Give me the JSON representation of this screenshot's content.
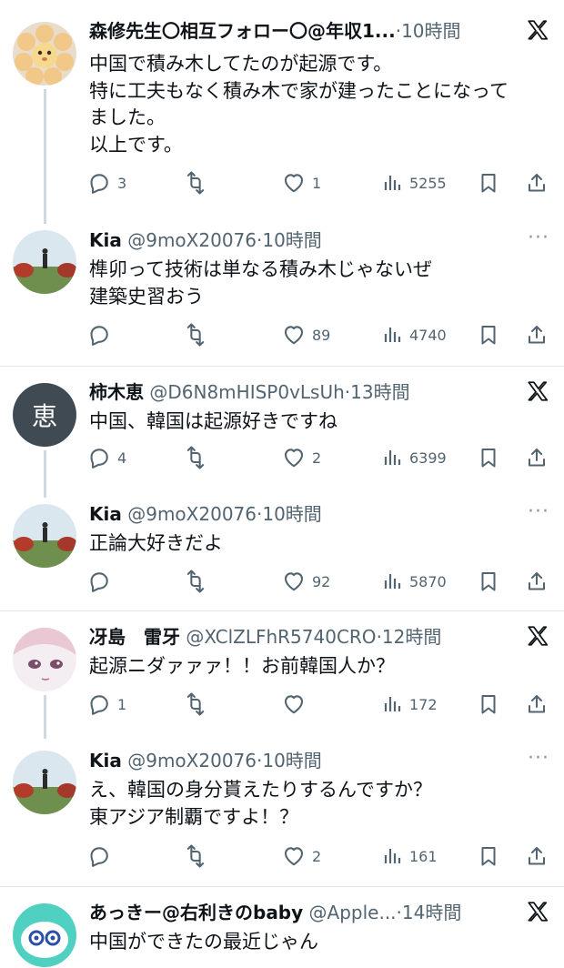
{
  "tweets": [
    {
      "name": "森修先生〇相互フォロー〇@年収1...",
      "handle": "",
      "time": "10時間",
      "lines": [
        "中国で積み木してたのが起源です。",
        "特に工夫もなく積み木で家が建ったことになって",
        "ました。",
        "以上です。"
      ],
      "reply_count": "3",
      "retweet_count": "",
      "like_count": "1",
      "view_count": "5255"
    },
    {
      "name": "Kia",
      "handle": "@9moX20076",
      "time": "10時間",
      "lines": [
        "榫卯って技術は単なる積み木じゃないぜ",
        "建築史習おう"
      ],
      "reply_count": "",
      "retweet_count": "",
      "like_count": "89",
      "view_count": "4740"
    },
    {
      "name": "柿木恵",
      "handle": "@D6N8mHISP0vLsUh",
      "time": "13時間",
      "avatar_text": "恵",
      "lines": [
        "中国、韓国は起源好きですね"
      ],
      "reply_count": "4",
      "retweet_count": "",
      "like_count": "2",
      "view_count": "6399"
    },
    {
      "name": "Kia",
      "handle": "@9moX20076",
      "time": "10時間",
      "lines": [
        "正論大好きだよ"
      ],
      "reply_count": "",
      "retweet_count": "",
      "like_count": "92",
      "view_count": "5870"
    },
    {
      "name": "冴島　雷牙",
      "handle": "@XClZLFhR5740CRO",
      "time": "12時間",
      "lines": [
        "起源ニダァァァ！！お前韓国人か？"
      ],
      "reply_count": "1",
      "retweet_count": "",
      "like_count": "",
      "view_count": "172"
    },
    {
      "name": "Kia",
      "handle": "@9moX20076",
      "time": "10時間",
      "lines": [
        "え、韓国の身分貰えたりするんですか？",
        "東アジア制覇ですよ！？"
      ],
      "reply_count": "",
      "retweet_count": "",
      "like_count": "2",
      "view_count": "161"
    },
    {
      "name": "あっきー@右利きのbaby",
      "handle": "@Apple...",
      "time": "14時間",
      "lines": [
        "中国ができたの最近じゃん"
      ]
    }
  ],
  "separator": "·",
  "icons": {
    "x_logo": "x-logo-icon",
    "more": "more-horizontal-icon",
    "reply": "reply-icon",
    "retweet": "retweet-icon",
    "like": "heart-icon",
    "views": "views-chart-icon",
    "bookmark": "bookmark-icon",
    "share": "share-icon"
  },
  "colors": {
    "text": "#0f1419",
    "secondary": "#536471",
    "thread_line": "#cfd9de",
    "divider": "#e1e8ed",
    "avatar_dark": "#3f4a52"
  }
}
